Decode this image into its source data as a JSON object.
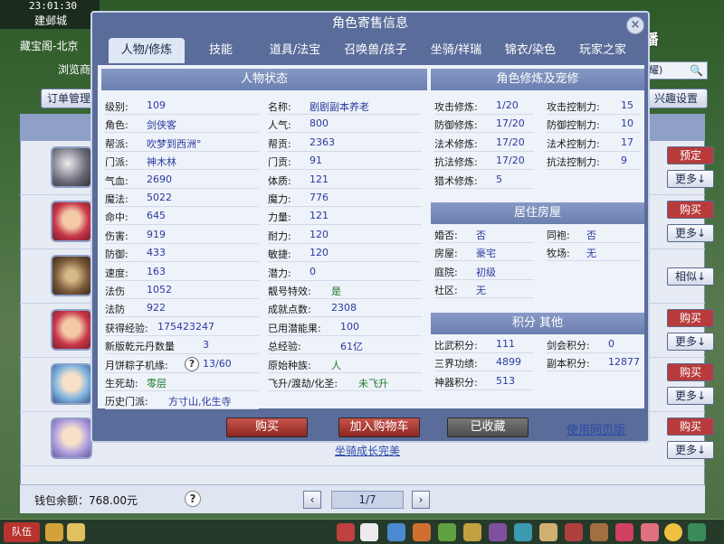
{
  "status": {
    "clock": "23:01:30",
    "city": "建邺城"
  },
  "background": {
    "treasure_title": "藏宝阁-北京",
    "browse_label": "浏览商",
    "order_button": "订单管理",
    "interest_button": "兴趣设置",
    "search_text": "耀)",
    "rows": [
      {
        "buttons": [
          "预定",
          "更多↓"
        ]
      },
      {
        "buttons": [
          "购买",
          "更多↓"
        ]
      },
      {
        "buttons": [
          "相似↓"
        ]
      },
      {
        "buttons": [
          "购买",
          "更多↓"
        ]
      },
      {
        "buttons": [
          "购买",
          "更多↓"
        ]
      },
      {
        "buttons": [
          "购买",
          "更多↓"
        ]
      }
    ],
    "below_text": "坐骑成长完美",
    "wallet": "钱包余额：768.00元",
    "page": "1/7",
    "team": "队伍"
  },
  "watermark": "CC直播",
  "modal": {
    "title": "角色寄售信息",
    "close": "×",
    "tabs": [
      "人物/修炼",
      "技能",
      "道具/法宝",
      "召唤兽/孩子",
      "坐骑/祥瑞",
      "锦衣/染色",
      "玩家之家"
    ],
    "status_section": {
      "title": "人物状态",
      "left": [
        {
          "label": "级别:",
          "value": "109"
        },
        {
          "label": "角色:",
          "value": "剑侠客"
        },
        {
          "label": "帮派:",
          "value": "吹梦到西洲°"
        },
        {
          "label": "门派:",
          "value": "神木林"
        },
        {
          "label": "气血:",
          "value": "2690"
        },
        {
          "label": "魔法:",
          "value": "5022"
        },
        {
          "label": "命中:",
          "value": "645"
        },
        {
          "label": "伤害:",
          "value": "919"
        },
        {
          "label": "防御:",
          "value": "433"
        },
        {
          "label": "速度:",
          "value": "163"
        },
        {
          "label": "法伤",
          "value": "1052"
        },
        {
          "label": "法防",
          "value": "922"
        },
        {
          "label": "获得经验:",
          "value": "175423247"
        },
        {
          "label": "新版乾元丹数量",
          "value": "3"
        },
        {
          "label": "月饼粽子机缘:",
          "value": "13/60"
        },
        {
          "label": "生死劫:",
          "value": "零层"
        },
        {
          "label": "历史门派:",
          "value": "方寸山,化生寺"
        }
      ],
      "right": [
        {
          "label": "名称:",
          "value": "剧剧副本养老"
        },
        {
          "label": "人气:",
          "value": "800"
        },
        {
          "label": "帮贡:",
          "value": "2363"
        },
        {
          "label": "门贡:",
          "value": "91"
        },
        {
          "label": "体质:",
          "value": "121"
        },
        {
          "label": "魔力:",
          "value": "776"
        },
        {
          "label": "力量:",
          "value": "121"
        },
        {
          "label": "耐力:",
          "value": "120"
        },
        {
          "label": "敏捷:",
          "value": "120"
        },
        {
          "label": "潜力:",
          "value": "0"
        },
        {
          "label": "靓号特效:",
          "value": "是"
        },
        {
          "label": "成就点数:",
          "value": "2308"
        },
        {
          "label": "已用潜能果:",
          "value": "100"
        },
        {
          "label": "总经验:",
          "value": "61亿"
        },
        {
          "label": "原始种族:",
          "value": "人"
        },
        {
          "label": "飞升/渡劫/化圣:",
          "value": "未飞升"
        }
      ]
    },
    "cultivation_section": {
      "title": "角色修炼及宠修",
      "left": [
        {
          "label": "攻击修炼:",
          "value": "1/20"
        },
        {
          "label": "防御修炼:",
          "value": "17/20"
        },
        {
          "label": "法术修炼:",
          "value": "17/20"
        },
        {
          "label": "抗法修炼:",
          "value": "17/20"
        },
        {
          "label": "猎术修炼:",
          "value": "5"
        }
      ],
      "right": [
        {
          "label": "攻击控制力:",
          "value": "15"
        },
        {
          "label": "防御控制力:",
          "value": "10"
        },
        {
          "label": "法术控制力:",
          "value": "17"
        },
        {
          "label": "抗法控制力:",
          "value": "9"
        }
      ]
    },
    "housing_section": {
      "title": "居住房屋",
      "left": [
        {
          "label": "婚否:",
          "value": "否"
        },
        {
          "label": "房屋:",
          "value": "豪宅"
        },
        {
          "label": "庭院:",
          "value": "初级"
        },
        {
          "label": "社区:",
          "value": "无"
        }
      ],
      "right": [
        {
          "label": "同袍:",
          "value": "否"
        },
        {
          "label": "牧场:",
          "value": "无"
        }
      ]
    },
    "points_section": {
      "title": "积分 其他",
      "left": [
        {
          "label": "比武积分:",
          "value": "111"
        },
        {
          "label": "三界功绩:",
          "value": "4899"
        },
        {
          "label": "神器积分:",
          "value": "513"
        }
      ],
      "right": [
        {
          "label": "剑会积分:",
          "value": "0"
        },
        {
          "label": "副本积分:",
          "value": "12877"
        }
      ]
    },
    "actions": {
      "buy": "购买",
      "add_cart": "加入购物车",
      "collected": "已收藏",
      "web_version": "使用网页版"
    }
  }
}
